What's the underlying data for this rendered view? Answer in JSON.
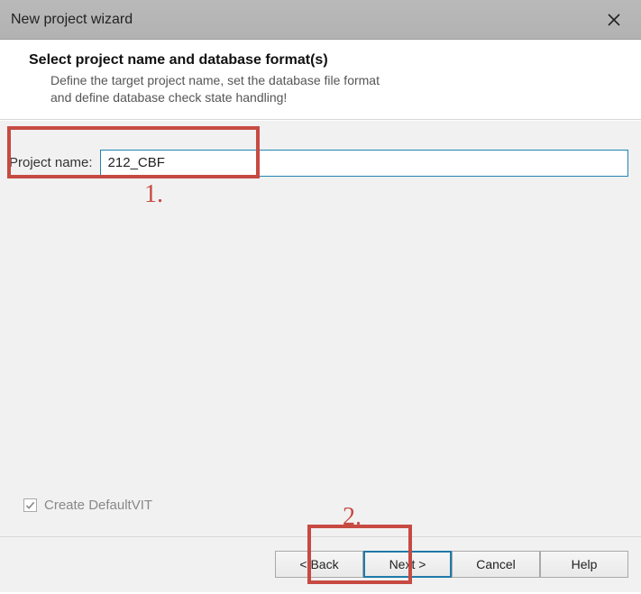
{
  "window": {
    "title": "New project wizard"
  },
  "header": {
    "title": "Select project name and database format(s)",
    "description": "Define the target project name, set the database file format\nand define database check state handling!"
  },
  "form": {
    "project_name_label": "Project name:",
    "project_name_value": "212_CBF",
    "create_default_vit_label": "Create DefaultVIT",
    "create_default_vit_checked": true
  },
  "buttons": {
    "back": "< Back",
    "next": "Next >",
    "cancel": "Cancel",
    "help": "Help"
  },
  "annotations": {
    "label1": "1.",
    "label2": "2."
  }
}
